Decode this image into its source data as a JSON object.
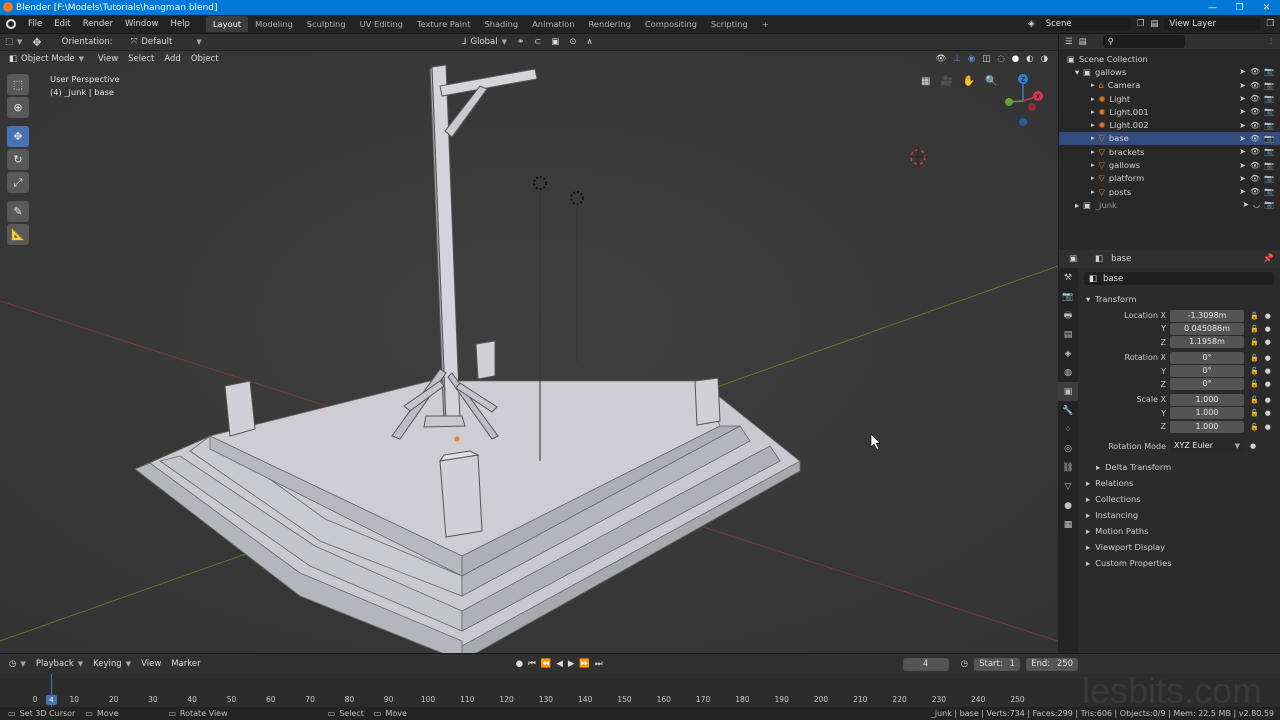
{
  "titlebar": {
    "title": "Blender [F:\\Models\\Tutorials\\hangman.blend]",
    "minimize": "—",
    "maximize": "❐",
    "close": "✕"
  },
  "menu": [
    "File",
    "Edit",
    "Render",
    "Window",
    "Help"
  ],
  "workspaces": [
    "Layout",
    "Modeling",
    "Sculpting",
    "UV Editing",
    "Texture Paint",
    "Shading",
    "Animation",
    "Rendering",
    "Compositing",
    "Scripting"
  ],
  "workspace_add": "+",
  "scene": {
    "name": "Scene",
    "view_layer": "View Layer"
  },
  "toolheader": {
    "orientation_label": "Orientation:",
    "orientation_value": "Default",
    "transform_orientation": "Global"
  },
  "viewport_header": {
    "mode": "Object Mode",
    "menus": [
      "View",
      "Select",
      "Add",
      "Object"
    ]
  },
  "viewport_overlay": {
    "perspective": "User Perspective",
    "collection": "(4) _junk | base"
  },
  "gizmo": {
    "x": "X",
    "y": "Y",
    "z": "Z"
  },
  "outliner": {
    "root": "Scene Collection",
    "collection": "gallows",
    "items": [
      {
        "name": "Camera",
        "selected": false
      },
      {
        "name": "Light",
        "selected": false
      },
      {
        "name": "Light.001",
        "selected": false
      },
      {
        "name": "Light.002",
        "selected": false
      },
      {
        "name": "base",
        "selected": true
      },
      {
        "name": "brackets",
        "selected": false
      },
      {
        "name": "gallows",
        "selected": false
      },
      {
        "name": "platform",
        "selected": false
      },
      {
        "name": "posts",
        "selected": false
      }
    ],
    "junk": "_junk"
  },
  "properties": {
    "object_name": "base",
    "name_field": "base",
    "transform_title": "Transform",
    "location": [
      {
        "label": "Location X",
        "value": "-1.3098m"
      },
      {
        "label": "Y",
        "value": "0.045086m"
      },
      {
        "label": "Z",
        "value": "1.1958m"
      }
    ],
    "rotation": [
      {
        "label": "Rotation X",
        "value": "0°"
      },
      {
        "label": "Y",
        "value": "0°"
      },
      {
        "label": "Z",
        "value": "0°"
      }
    ],
    "scale": [
      {
        "label": "Scale X",
        "value": "1.000"
      },
      {
        "label": "Y",
        "value": "1.000"
      },
      {
        "label": "Z",
        "value": "1.000"
      }
    ],
    "rotation_mode_label": "Rotation Mode",
    "rotation_mode_value": "XYZ Euler",
    "delta": "Delta Transform",
    "panels": [
      "Relations",
      "Collections",
      "Instancing",
      "Motion Paths",
      "Viewport Display",
      "Custom Properties"
    ]
  },
  "timeline": {
    "menus": [
      "Playback",
      "Keying",
      "View",
      "Marker"
    ],
    "current_frame": "4",
    "start_label": "Start:",
    "start": "1",
    "end_label": "End:",
    "end": "250",
    "ticks": [
      "0",
      "10",
      "20",
      "30",
      "40",
      "50",
      "60",
      "70",
      "80",
      "90",
      "100",
      "110",
      "120",
      "130",
      "140",
      "150",
      "160",
      "170",
      "180",
      "190",
      "200",
      "210",
      "220",
      "230",
      "240",
      "250"
    ]
  },
  "statusbar": {
    "left": [
      "Set 3D Cursor",
      "Move",
      "Rotate View",
      "Select",
      "Move"
    ],
    "stats": "_junk | base | Verts:734 | Faces:299 | Tris:606 | Objects:0/9 | Mem: 22.5 MB | v2.80.59"
  },
  "watermark": "lesbits.com"
}
